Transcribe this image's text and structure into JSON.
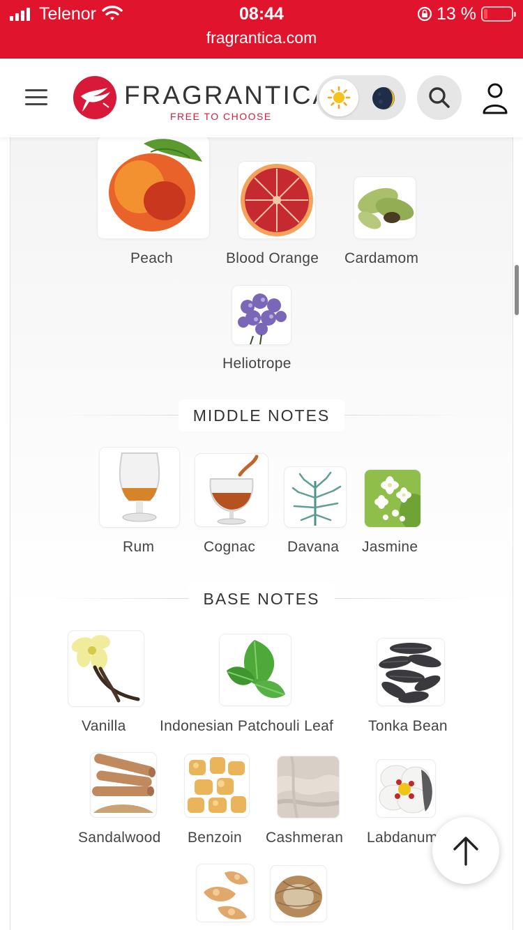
{
  "status_bar": {
    "carrier": "Telenor",
    "time": "08:44",
    "battery": "13 %",
    "url": "fragrantica.com"
  },
  "header": {
    "logo_text": "FRAGRANTICA",
    "logo_tagline": "FREE TO CHOOSE"
  },
  "top_notes": [
    {
      "name": "Peach",
      "icon": "peach"
    },
    {
      "name": "Blood Orange",
      "icon": "blood-orange"
    },
    {
      "name": "Cardamom",
      "icon": "cardamom"
    },
    {
      "name": "Heliotrope",
      "icon": "heliotrope"
    }
  ],
  "middle_notes": {
    "title": "MIDDLE NOTES",
    "items": [
      {
        "name": "Rum",
        "icon": "rum-glass"
      },
      {
        "name": "Cognac",
        "icon": "cognac-glass"
      },
      {
        "name": "Davana",
        "icon": "davana-plant"
      },
      {
        "name": "Jasmine",
        "icon": "jasmine-flower"
      }
    ]
  },
  "base_notes": {
    "title": "BASE NOTES",
    "items": [
      {
        "name": "Vanilla",
        "icon": "vanilla"
      },
      {
        "name": "Indonesian Patchouli Leaf",
        "icon": "patchouli-leaf"
      },
      {
        "name": "Tonka Bean",
        "icon": "tonka-bean"
      },
      {
        "name": "Sandalwood",
        "icon": "sandalwood"
      },
      {
        "name": "Benzoin",
        "icon": "benzoin"
      },
      {
        "name": "Cashmeran",
        "icon": "cashmeran"
      },
      {
        "name": "Labdanum",
        "icon": "labdanum"
      },
      {
        "name": "",
        "icon": "resin-pieces"
      },
      {
        "name": "",
        "icon": "root-fibers"
      }
    ]
  },
  "colors": {
    "brand_red": "#e0142c",
    "tagline_red": "#d41e3a"
  }
}
